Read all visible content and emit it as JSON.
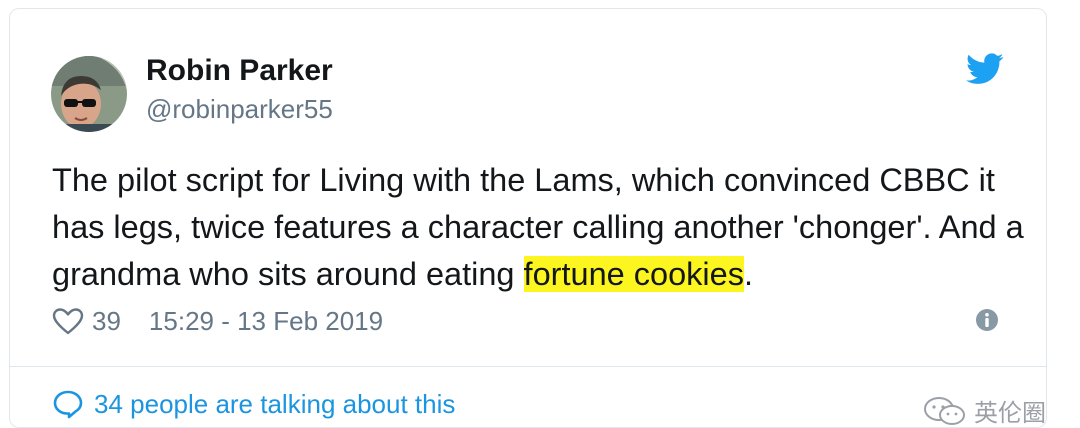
{
  "tweet": {
    "author_name": "Robin Parker",
    "author_handle": "@robinparker55",
    "text_before": "The pilot script for Living with the Lams, which convinced CBBC it has legs, twice features a character calling another 'chonger'. And a grandma who sits around eating ",
    "text_highlight": "fortune cookies",
    "text_after": ".",
    "likes": "39",
    "timestamp": "15:29 - 13 Feb 2019",
    "talking_label": "34 people are talking about this"
  },
  "watermark": {
    "text": "英伦圈"
  },
  "icons": {
    "brand": "twitter-bird-icon",
    "like": "heart-icon",
    "info": "info-icon",
    "reply": "speech-bubble-icon",
    "watermark": "wechat-icon"
  },
  "colors": {
    "accent": "#1da1f2",
    "link": "#1b95e0",
    "secondary_text": "#657786",
    "highlight": "#fcf520"
  }
}
